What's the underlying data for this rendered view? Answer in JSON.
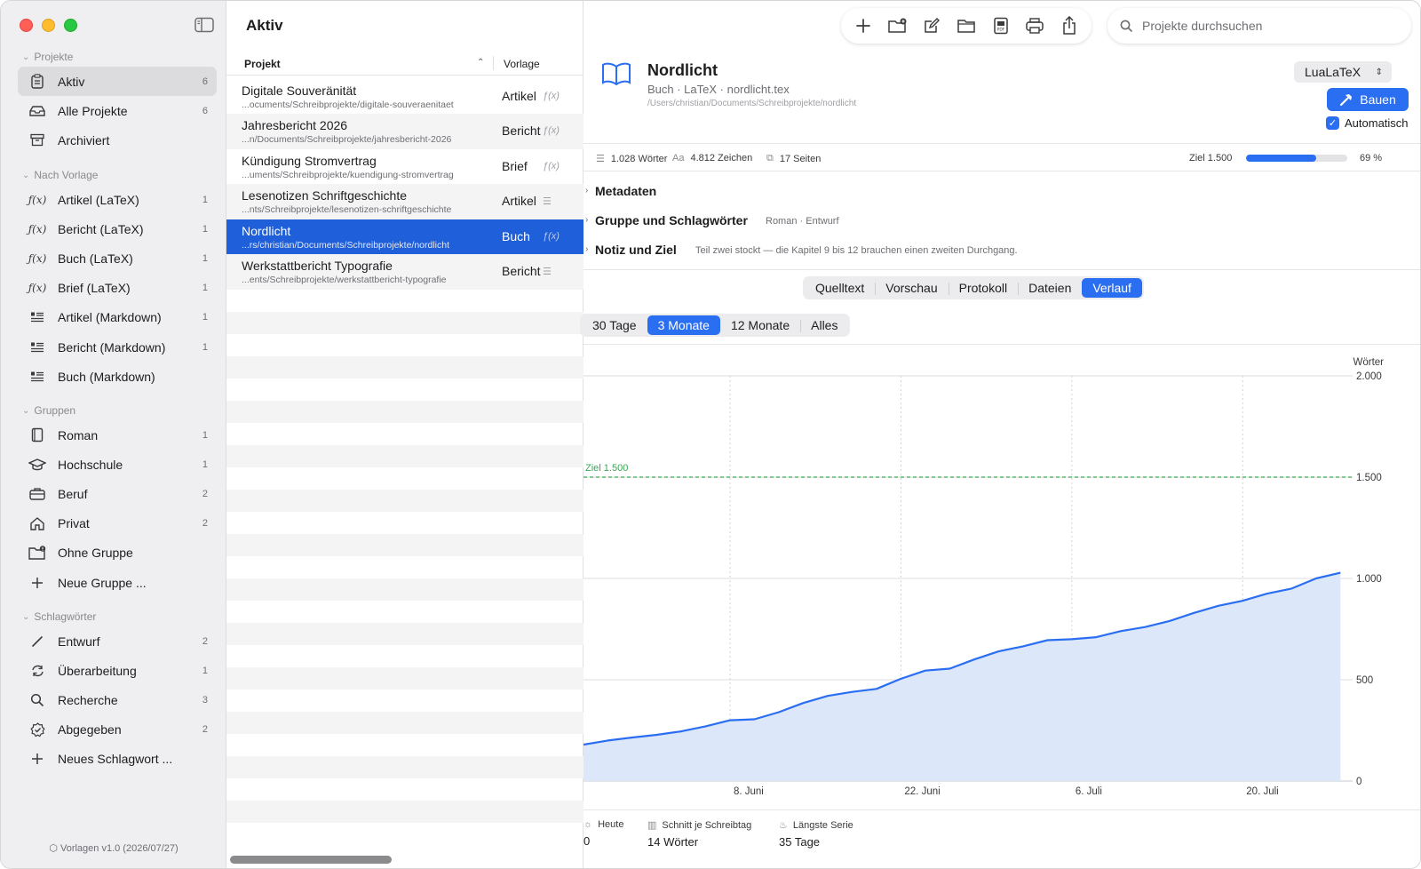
{
  "sidebar": {
    "sections": [
      {
        "title": "Projekte",
        "items": [
          {
            "label": "Aktiv",
            "count": "6",
            "icon": "clipboard-icon",
            "active": true
          },
          {
            "label": "Alle Projekte",
            "count": "6",
            "icon": "tray-icon"
          },
          {
            "label": "Archiviert",
            "count": "",
            "icon": "archive-box-icon"
          }
        ]
      },
      {
        "title": "Nach Vorlage",
        "items": [
          {
            "label": "Artikel (LaTeX)",
            "count": "1",
            "icon": "function-icon"
          },
          {
            "label": "Bericht (LaTeX)",
            "count": "1",
            "icon": "function-icon"
          },
          {
            "label": "Buch (LaTeX)",
            "count": "1",
            "icon": "function-icon"
          },
          {
            "label": "Brief (LaTeX)",
            "count": "1",
            "icon": "function-icon"
          },
          {
            "label": "Artikel (Markdown)",
            "count": "1",
            "icon": "text-lines-icon"
          },
          {
            "label": "Bericht (Markdown)",
            "count": "1",
            "icon": "text-lines-icon"
          },
          {
            "label": "Buch (Markdown)",
            "count": "",
            "icon": "text-lines-icon"
          }
        ]
      },
      {
        "title": "Gruppen",
        "items": [
          {
            "label": "Roman",
            "count": "1",
            "icon": "book-closed-icon"
          },
          {
            "label": "Hochschule",
            "count": "1",
            "icon": "graduation-cap-icon"
          },
          {
            "label": "Beruf",
            "count": "2",
            "icon": "briefcase-icon"
          },
          {
            "label": "Privat",
            "count": "2",
            "icon": "house-icon"
          },
          {
            "label": "Ohne Gruppe",
            "count": "",
            "icon": "folder-badge-icon"
          },
          {
            "label": "Neue Gruppe ...",
            "count": "",
            "icon": "plus-icon"
          }
        ]
      },
      {
        "title": "Schlagwörter",
        "items": [
          {
            "label": "Entwurf",
            "count": "2",
            "icon": "pencil-icon"
          },
          {
            "label": "Überarbeitung",
            "count": "1",
            "icon": "arrows-circle-icon"
          },
          {
            "label": "Recherche",
            "count": "3",
            "icon": "magnifier-icon"
          },
          {
            "label": "Abgegeben",
            "count": "2",
            "icon": "checkmark-seal-icon"
          },
          {
            "label": "Neues Schlagwort ...",
            "count": "",
            "icon": "plus-icon"
          }
        ]
      }
    ],
    "footer": "Vorlagen v1.0 (2026/07/27)"
  },
  "list": {
    "title": "Aktiv",
    "col_project": "Projekt",
    "col_template": "Vorlage",
    "rows": [
      {
        "name": "Digitale Souveränität",
        "path": "...ocuments/Schreibprojekte/digitale-souveraenitaet",
        "template": "Artikel",
        "kind": "latex"
      },
      {
        "name": "Jahresbericht 2026",
        "path": "...n/Documents/Schreibprojekte/jahresbericht-2026",
        "template": "Bericht",
        "kind": "latex"
      },
      {
        "name": "Kündigung Stromvertrag",
        "path": "...uments/Schreibprojekte/kuendigung-stromvertrag",
        "template": "Brief",
        "kind": "latex"
      },
      {
        "name": "Lesenotizen Schriftgeschichte",
        "path": "...nts/Schreibprojekte/lesenotizen-schriftgeschichte",
        "template": "Artikel",
        "kind": "markdown"
      },
      {
        "name": "Nordlicht",
        "path": "...rs/christian/Documents/Schreibprojekte/nordlicht",
        "template": "Buch",
        "kind": "latex",
        "selected": true
      },
      {
        "name": "Werkstattbericht Typografie",
        "path": "...ents/Schreibprojekte/werkstattbericht-typografie",
        "template": "Bericht",
        "kind": "markdown"
      }
    ]
  },
  "search": {
    "placeholder": "Projekte durchsuchen"
  },
  "toolbar": {
    "icons": [
      "plus-icon",
      "new-folder-icon",
      "compose-icon",
      "folder-icon",
      "pdf-document-icon",
      "printer-icon",
      "share-icon"
    ]
  },
  "detail": {
    "title": "Nordlicht",
    "subtitle": "Buch · LaTeX · nordlicht.tex",
    "path": "/Users/christian/Documents/Schreibprojekte/nordlicht",
    "engine": "LuaLaTeX",
    "build_label": "Bauen",
    "auto_label": "Automatisch",
    "auto_checked": true,
    "stats": {
      "words": "1.028 Wörter",
      "chars_prefix": "Aa",
      "chars": "4.812 Zeichen",
      "pages": "17 Seiten",
      "goal_label": "Ziel 1.500",
      "goal_fraction": 0.69,
      "goal_pct": "69 %"
    },
    "disclosures": [
      {
        "title": "Metadaten",
        "extra": ""
      },
      {
        "title": "Gruppe und Schlagwörter",
        "extra": "Roman · Entwurf"
      },
      {
        "title": "Notiz und Ziel",
        "extra": "Teil zwei stockt — die Kapitel 9 bis 12 brauchen einen zweiten Durchgang."
      }
    ],
    "tabs": [
      "Quelltext",
      "Vorschau",
      "Protokoll",
      "Dateien",
      "Verlauf"
    ],
    "active_tab": "Verlauf",
    "ranges": [
      "30 Tage",
      "3 Monate",
      "12 Monate",
      "Alles"
    ],
    "active_range": "3 Monate",
    "footer": {
      "today_label": "Heute",
      "today_value": "0",
      "avg_label": "Schnitt je Schreibtag",
      "avg_value": "14 Wörter",
      "streak_label": "Längste Serie",
      "streak_value": "35 Tage"
    }
  },
  "colors": {
    "accent": "#2a6ef2",
    "selection": "#1f5fd9",
    "goal_line": "#3aa655",
    "area_fill": "#dde7fa"
  },
  "chart_data": {
    "type": "area",
    "ylabel": "Wörter",
    "ylim": [
      0,
      2000
    ],
    "yticks": [
      "0",
      "500",
      "1.000",
      "1.500",
      "2.000"
    ],
    "ytick_values": [
      0,
      500,
      1000,
      1500,
      2000
    ],
    "xticks": [
      "8. Juni",
      "22. Juni",
      "6. Juli",
      "20. Juli"
    ],
    "x_start": "2026-05-27",
    "x_end": "2026-07-29",
    "xtick_dates": [
      "2026-06-08",
      "2026-06-22",
      "2026-07-06",
      "2026-07-20"
    ],
    "goal": {
      "label": "Ziel 1.500",
      "value": 1500
    },
    "series": [
      {
        "x": [
          "2026-05-27",
          "2026-05-29",
          "2026-05-31",
          "2026-06-02",
          "2026-06-04",
          "2026-06-06",
          "2026-06-08",
          "2026-06-10",
          "2026-06-12",
          "2026-06-14",
          "2026-06-16",
          "2026-06-18",
          "2026-06-20",
          "2026-06-22",
          "2026-06-24",
          "2026-06-26",
          "2026-06-28",
          "2026-06-30",
          "2026-07-02",
          "2026-07-04",
          "2026-07-06",
          "2026-07-08",
          "2026-07-10",
          "2026-07-12",
          "2026-07-14",
          "2026-07-16",
          "2026-07-18",
          "2026-07-20",
          "2026-07-22",
          "2026-07-24",
          "2026-07-26",
          "2026-07-28"
        ],
        "values": [
          180,
          200,
          215,
          228,
          245,
          270,
          300,
          305,
          340,
          385,
          420,
          440,
          455,
          505,
          545,
          555,
          600,
          640,
          665,
          695,
          700,
          710,
          740,
          760,
          790,
          830,
          865,
          890,
          925,
          950,
          1000,
          1028
        ]
      }
    ]
  }
}
